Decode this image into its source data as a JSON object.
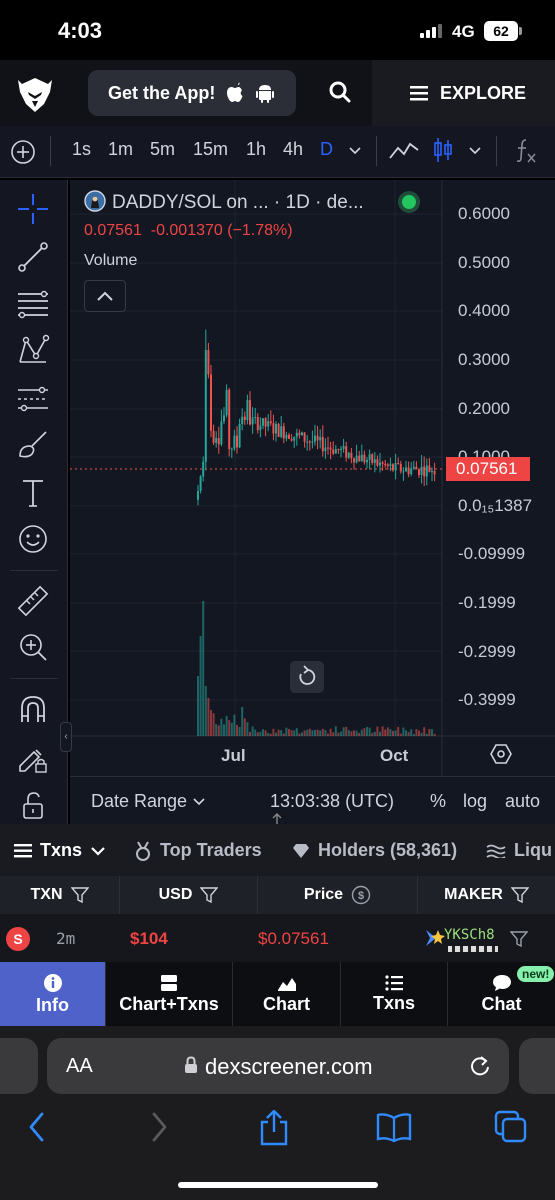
{
  "status_bar": {
    "time": "4:03",
    "network": "4G",
    "battery": "62"
  },
  "header": {
    "get_app_label": "Get the App!",
    "explore_label": "EXPLORE"
  },
  "toolbar": {
    "intervals": [
      "1s",
      "1m",
      "5m",
      "15m",
      "1h",
      "4h",
      "D"
    ],
    "active_interval": "D",
    "active_color": "#2962ff"
  },
  "chart": {
    "legend_title": "DADDY/SOL on ... · 1D · de...",
    "legend_price": "0.07561",
    "legend_change": "-0.001370 (−1.78%)",
    "volume_label": "Volume",
    "y_labels": [
      "0.6000",
      "0.5000",
      "0.4000",
      "0.3000",
      "0.2000",
      "0.1000",
      "0.0₁₅1387",
      "-0.09999",
      "-0.1999",
      "-0.2999",
      "-0.3999"
    ],
    "current_price": "0.07561",
    "x_labels": [
      "Jul",
      "Oct"
    ],
    "date_range_label": "Date Range",
    "clock": "13:03:38 (UTC)",
    "pct_label": "%",
    "log_label": "log",
    "auto_label": "auto",
    "up_color": "#26a69a",
    "down_color": "#ef5350"
  },
  "tabs": {
    "txns": "Txns",
    "top_traders": "Top Traders",
    "holders": "Holders (58,361)",
    "liquidity": "Liqu"
  },
  "table": {
    "headers": [
      "TXN",
      "USD",
      "Price",
      "MAKER"
    ],
    "rows": [
      {
        "side": "S",
        "age": "2m",
        "usd": "$104",
        "price": "$0.07561",
        "maker": "YKSCh8"
      }
    ]
  },
  "bottom_nav": {
    "info": "Info",
    "chart_txns": "Chart+Txns",
    "chart": "Chart",
    "txns": "Txns",
    "chat": "Chat",
    "new_badge": "new!"
  },
  "browser": {
    "aa": "AA",
    "url": "dexscreener.com"
  }
}
